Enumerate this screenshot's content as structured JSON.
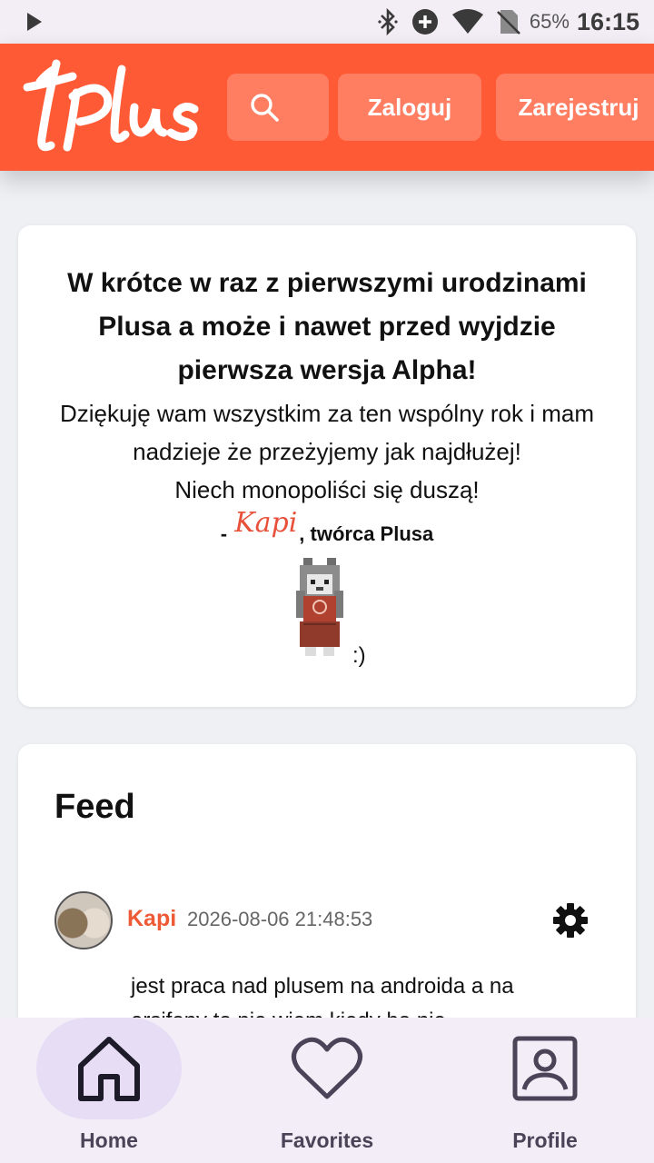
{
  "statusbar": {
    "battery": "65%",
    "time": "16:15",
    "icons": [
      "play-icon",
      "bluetooth-icon",
      "add-circle-icon",
      "wifi-icon",
      "no-sim-icon"
    ]
  },
  "header": {
    "logo_text": "+Plus",
    "login_label": "Zaloguj",
    "register_label": "Zarejestruj",
    "search_icon": "search-icon",
    "accent_color": "#ff5a36"
  },
  "announcement": {
    "title": "W krótce w raz z pierwszymi urodzinami Plusa a może i nawet przed wyjdzie pierwsza wersja Alpha!",
    "body_line1": "Dziękuję wam wszystkim za ten wspólny rok i mam nadzieje że przeżyjemy jak najdłużej!",
    "body_line2": "Niech monopoliści się duszą!",
    "sign_prefix": "- ",
    "sign_name": "Kapi",
    "sign_suffix": ", twórca Plusa",
    "smile": ":)"
  },
  "feed": {
    "title": "Feed",
    "posts": [
      {
        "author": "Kapi",
        "date": "2026-08-06 21:48:53",
        "text": "jest praca nad plusem na androida a na ersifony to nie wiem kiedy bo nie"
      }
    ]
  },
  "bottom_nav": {
    "items": [
      {
        "label": "Home",
        "icon": "home-icon",
        "active": true
      },
      {
        "label": "Favorites",
        "icon": "heart-icon",
        "active": false
      },
      {
        "label": "Profile",
        "icon": "profile-icon",
        "active": false
      }
    ]
  }
}
